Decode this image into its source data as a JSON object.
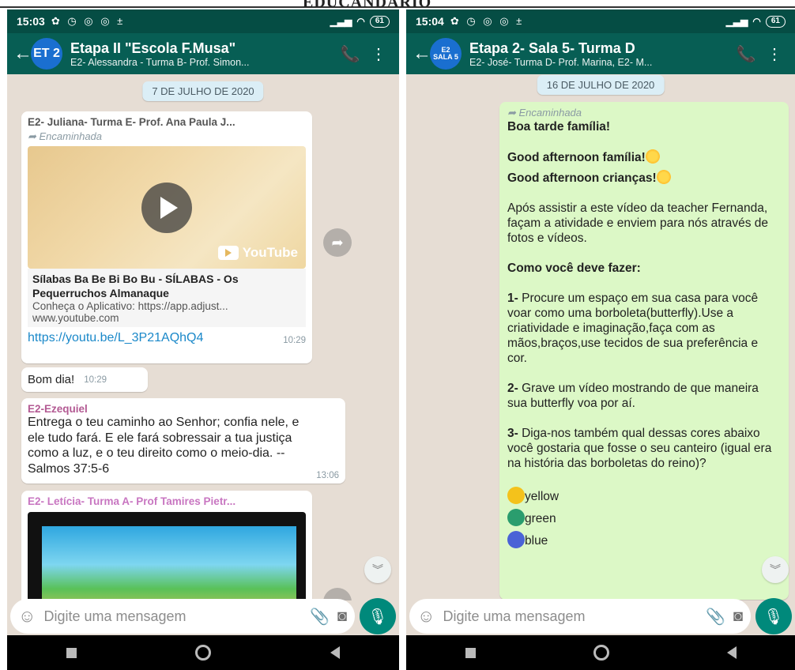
{
  "doc_title": "EDUCANDARIO",
  "left": {
    "status": {
      "time": "15:03",
      "icons": "✿ ◷ ◎ ◎ ±",
      "battery": "61"
    },
    "header": {
      "avatar": "ET 2",
      "title": "Etapa II \"Escola F.Musa\"",
      "subtitle": "E2- Alessandra - Turma B- Prof. Simon..."
    },
    "date_chip": "7 DE JULHO DE 2020",
    "msg1": {
      "sender": "E2- Juliana- Turma E- Prof. Ana Paula J...",
      "forwarded": "Encaminhada",
      "yt_badge": "YouTube",
      "preview_title": "Sílabas Ba Be Bi Bo Bu - SÍLABAS - Os Pequerruchos Almanaque",
      "preview_desc": "Conheça o Aplicativo: https://app.adjust...",
      "preview_domain": "www.youtube.com",
      "link": "https://youtu.be/L_3P21AQhQ4",
      "time": "10:29"
    },
    "msg2": {
      "text": "Bom dia!",
      "time": "10:29"
    },
    "msg3": {
      "sender": "E2-Ezequiel",
      "text": "Entrega o teu caminho ao Senhor; confia nele, e ele tudo fará. E ele fará sobressair a tua justiça como a luz, e o teu direito como o meio-dia. -- Salmos 37:5-6",
      "time": "13:06"
    },
    "msg4": {
      "sender": "E2- Letícia- Turma A- Prof Tamires Pietr..."
    },
    "input_placeholder": "Digite uma mensagem"
  },
  "right": {
    "status": {
      "time": "15:04",
      "icons": "✿ ◷ ◎ ◎ ±",
      "battery": "61"
    },
    "header": {
      "avatar_line1": "E2",
      "avatar_line2": "SALA 5",
      "title": "Etapa 2- Sala 5- Turma D",
      "subtitle": "E2- José- Turma D- Prof. Marina, E2- M..."
    },
    "date_chip": "16 DE JULHO DE 2020",
    "msg": {
      "forwarded": "Encaminhada",
      "greeting1": "Boa tarde família!",
      "greeting2": "Good afternoon família!",
      "greeting3": "Good afternoon crianças!",
      "intro": "Após assistir a este vídeo da teacher Fernanda, façam a atividade e enviem para nós através de fotos e vídeos.",
      "how_title": "Como você deve fazer:",
      "step1_num": "1-",
      "step1": " Procure um espaço em sua casa para  você voar como uma borboleta(butterfly).Use a criatividade e imaginação,faça  com as mãos,braços,use tecidos  de sua preferência e cor.",
      "step2_num": "2-",
      "step2": " Grave um vídeo mostrando de que maneira sua butterfly voa por aí.",
      "step3_num": "3-",
      "step3": " Diga-nos também qual dessas cores abaixo você gostaria que fosse o seu canteiro (igual era na história das borboletas do reino)?",
      "colors": [
        {
          "label": "yellow",
          "hex": "#f4c21b"
        },
        {
          "label": "green",
          "hex": "#2a9d6e"
        },
        {
          "label": "blue",
          "hex": "#4a63d6"
        }
      ]
    },
    "input_placeholder": "Digite uma mensagem"
  },
  "colors": {
    "header": "#075e54",
    "status": "#054d44",
    "chat_bg": "#e6ddd4",
    "outgoing": "#dcf8c6",
    "accent": "#00897b"
  }
}
